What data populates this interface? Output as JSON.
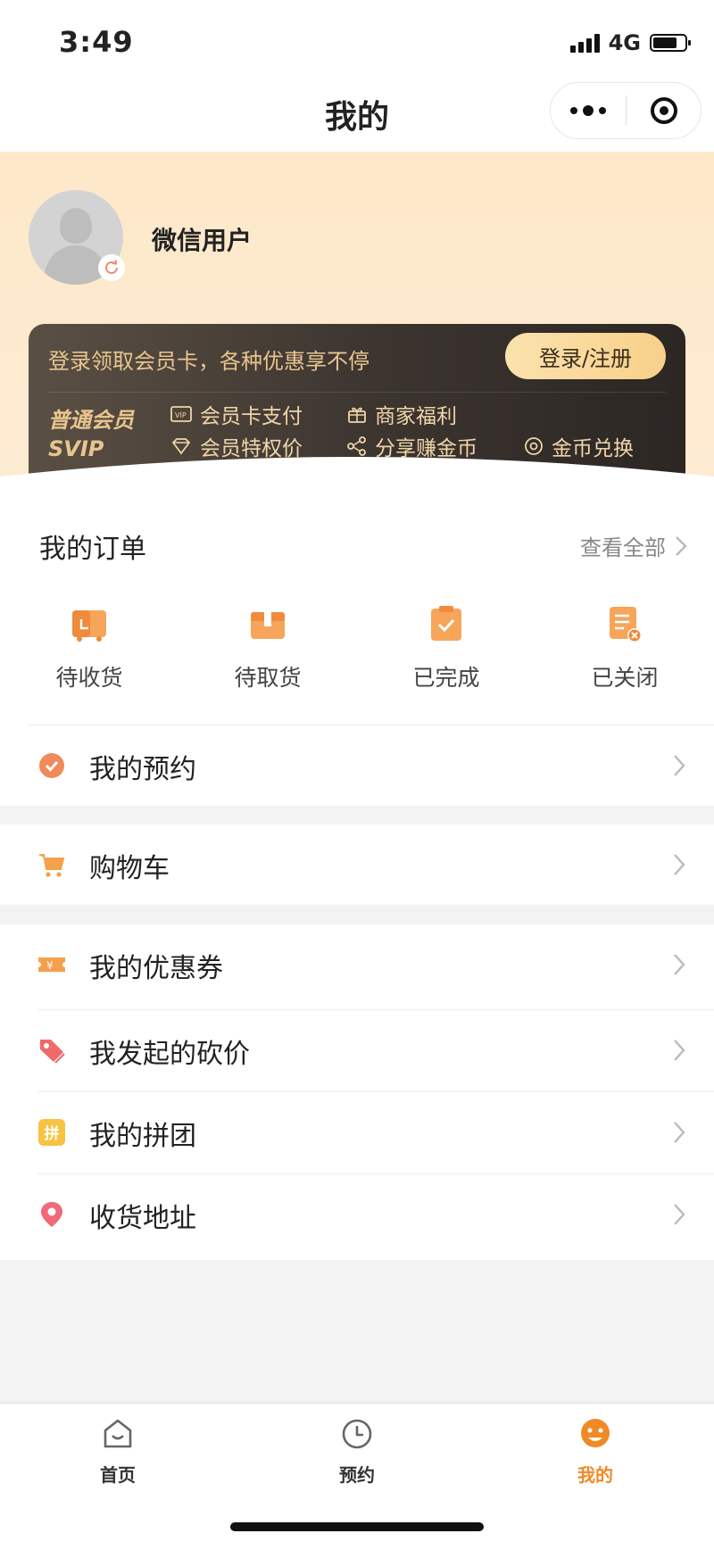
{
  "status_bar": {
    "time": "3:49",
    "network": "4G"
  },
  "nav": {
    "title": "我的"
  },
  "profile": {
    "username": "微信用户"
  },
  "vip_card": {
    "promo_text": "登录领取会员卡，各种优惠享不停",
    "login_button": "登录/注册",
    "level_primary": "普通会员",
    "level_secondary": "SVIP",
    "perks": {
      "card_pay": "会员卡支付",
      "merchant_benefits": "商家福利",
      "member_price": "会员特权价",
      "share_coins": "分享赚金币",
      "coin_exchange": "金币兑换"
    }
  },
  "orders": {
    "title": "我的订单",
    "view_all": "查看全部",
    "items": [
      "待收货",
      "待取货",
      "已完成",
      "已关闭"
    ]
  },
  "menu": {
    "appointment": "我的预约",
    "cart": "购物车",
    "coupons": "我的优惠券",
    "bargain": "我发起的砍价",
    "group_buy": "我的拼团",
    "address": "收货地址"
  },
  "tabbar": {
    "home": "首页",
    "booking": "预约",
    "mine": "我的"
  },
  "colors": {
    "accent": "#f08a27",
    "card_gold": "#e8c58e",
    "hero_bg": "#fde8c9"
  }
}
